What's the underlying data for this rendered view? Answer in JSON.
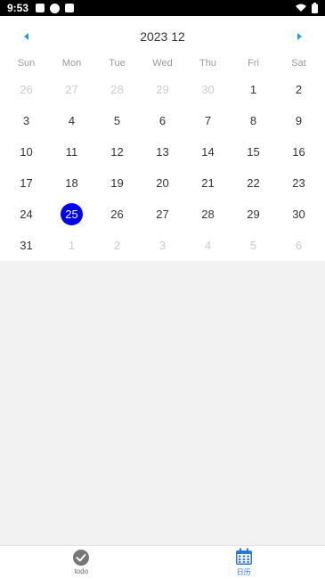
{
  "status_bar": {
    "time": "9:53"
  },
  "calendar": {
    "title": "2023 12",
    "weekdays": [
      "Sun",
      "Mon",
      "Tue",
      "Wed",
      "Thu",
      "Fri",
      "Sat"
    ],
    "days": [
      {
        "label": "26",
        "muted": true
      },
      {
        "label": "27",
        "muted": true
      },
      {
        "label": "28",
        "muted": true
      },
      {
        "label": "29",
        "muted": true
      },
      {
        "label": "30",
        "muted": true
      },
      {
        "label": "1"
      },
      {
        "label": "2"
      },
      {
        "label": "3"
      },
      {
        "label": "4"
      },
      {
        "label": "5"
      },
      {
        "label": "6"
      },
      {
        "label": "7"
      },
      {
        "label": "8"
      },
      {
        "label": "9"
      },
      {
        "label": "10"
      },
      {
        "label": "11"
      },
      {
        "label": "12"
      },
      {
        "label": "13"
      },
      {
        "label": "14"
      },
      {
        "label": "15"
      },
      {
        "label": "16"
      },
      {
        "label": "17"
      },
      {
        "label": "18"
      },
      {
        "label": "19"
      },
      {
        "label": "20"
      },
      {
        "label": "21"
      },
      {
        "label": "22"
      },
      {
        "label": "23"
      },
      {
        "label": "24"
      },
      {
        "label": "25",
        "selected": true
      },
      {
        "label": "26"
      },
      {
        "label": "27"
      },
      {
        "label": "28"
      },
      {
        "label": "29"
      },
      {
        "label": "30"
      },
      {
        "label": "31"
      },
      {
        "label": "1",
        "muted": true
      },
      {
        "label": "2",
        "muted": true
      },
      {
        "label": "3",
        "muted": true
      },
      {
        "label": "4",
        "muted": true
      },
      {
        "label": "5",
        "muted": true
      },
      {
        "label": "6",
        "muted": true
      }
    ],
    "selected_color": "#0000ee",
    "nav_color": "#1aa3d6"
  },
  "tabbar": {
    "items": [
      {
        "label": "todo",
        "icon": "check-circle-icon",
        "active": false
      },
      {
        "label": "日历",
        "icon": "calendar-icon",
        "active": true
      }
    ],
    "active_color": "#2a78d6"
  }
}
